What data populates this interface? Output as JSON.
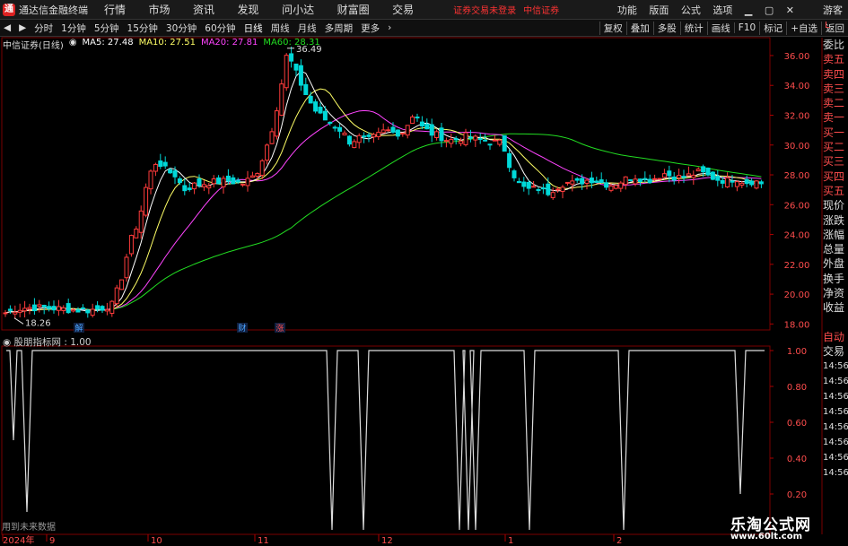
{
  "titlebar": {
    "app_title": "通达信金融终端",
    "menu": [
      "行情",
      "市场",
      "资讯",
      "发现",
      "问小达",
      "财富圈",
      "交易"
    ],
    "status": "证券交易未登录",
    "broker": "中信证券",
    "right_menu": [
      "功能",
      "版面",
      "公式",
      "选项"
    ],
    "guest": "游客"
  },
  "toolbar": {
    "periods": [
      "分时",
      "1分钟",
      "5分钟",
      "15分钟",
      "30分钟",
      "60分钟",
      "日线",
      "周线",
      "月线",
      "多周期",
      "更多"
    ],
    "selected": "日线",
    "right_tools": [
      "复权",
      "叠加",
      "多股",
      "统计",
      "画线",
      "F10",
      "标记",
      "+自选",
      "返回"
    ]
  },
  "main_chart": {
    "stock": "中信证券(日线)",
    "ma5": "MA5: 27.48",
    "ma10": "MA10: 27.51",
    "ma20": "MA20: 27.81",
    "ma60": "MA60: 28.31",
    "high_label": "36.49",
    "low_label": "18.26",
    "y_ticks": [
      "36.00",
      "34.00",
      "32.00",
      "30.00",
      "28.00",
      "26.00",
      "24.00",
      "22.00",
      "20.00",
      "18.00"
    ],
    "x_labels": [
      "2024年",
      "9",
      "10",
      "11",
      "12",
      "1",
      "2"
    ],
    "markers": [
      "解",
      "财",
      "涨"
    ],
    "colors": {
      "up": "#ff3b3b",
      "down": "#00d8d8",
      "ma5": "#ffffff",
      "ma10": "#ffff66",
      "ma20": "#ff44ff",
      "ma60": "#22dd22"
    }
  },
  "indicator": {
    "name": "股朋指标网 : 1.00",
    "y_ticks": [
      "1.00",
      "0.80",
      "0.60",
      "0.40",
      "0.20"
    ],
    "footer": "用到未来数据"
  },
  "right_panel": {
    "lchip": "L",
    "items": [
      "委比",
      "卖五",
      "卖四",
      "卖三",
      "卖二",
      "卖一",
      "买一",
      "买二",
      "买三",
      "买四",
      "买五",
      "现价",
      "涨跌",
      "涨幅",
      "总量",
      "外盘",
      "换手",
      "净资",
      "收益"
    ],
    "items2": [
      "自动",
      "交易"
    ],
    "times": [
      "14:56",
      "14:56",
      "14:56",
      "14:56",
      "14:56",
      "14:56",
      "14:56",
      "14:56"
    ]
  },
  "watermark": {
    "line1": "乐淘公式网",
    "line2": "www.60lt.com"
  }
}
